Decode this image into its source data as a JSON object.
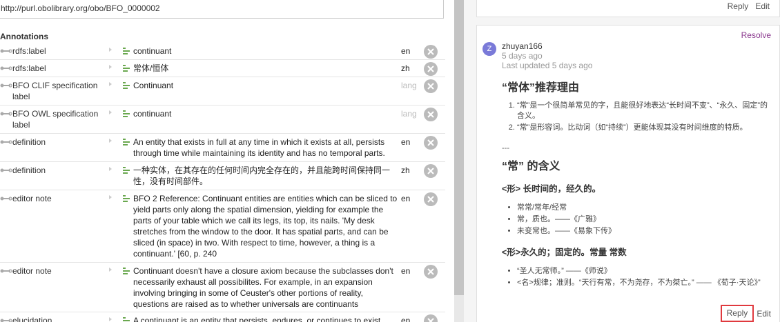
{
  "entity": {
    "iri": "http://purl.obolibrary.org/obo/BFO_0000002"
  },
  "annotations": {
    "heading": "Annotations",
    "rows": [
      {
        "property": "rdfs:label",
        "value": "continuant",
        "lang": "en",
        "lang_placeholder": false
      },
      {
        "property": "rdfs:label",
        "value": "常体/恒体",
        "lang": "zh",
        "lang_placeholder": false
      },
      {
        "property": "BFO CLIF specification label",
        "value": "Continuant",
        "lang": "lang",
        "lang_placeholder": true
      },
      {
        "property": "BFO OWL specification label",
        "value": "continuant",
        "lang": "lang",
        "lang_placeholder": true
      },
      {
        "property": "definition",
        "value": "An entity that exists in full at any time in which it exists at all, persists through time while maintaining its identity and has no temporal parts.",
        "lang": "en",
        "lang_placeholder": false
      },
      {
        "property": "definition",
        "value": "一种实体，在其存在的任何时间内完全存在的，并且能跨时间保持同一性，没有时间部件。",
        "lang": "zh",
        "lang_placeholder": false
      },
      {
        "property": "editor note",
        "value": "BFO 2 Reference: Continuant entities are entities which can be sliced to yield parts only along the spatial dimension, yielding for example the parts of your table which we call its legs, its top, its nails. 'My desk stretches from the window to the door. It has spatial parts, and can be sliced (in space) in two. With respect to time, however, a thing is a continuant.' [60, p. 240",
        "lang": "en",
        "lang_placeholder": false
      },
      {
        "property": "editor note",
        "value": "Continuant doesn't have a closure axiom because the subclasses don't necessarily exhaust all possibilites. For example, in an expansion involving bringing in some of Ceuster's other portions of reality, questions are raised as to whether universals are continuants",
        "lang": "en",
        "lang_placeholder": false
      },
      {
        "property": "elucidation",
        "value": "A continuant is an entity that persists, endures, or continues to exist",
        "lang": "en",
        "lang_placeholder": false
      }
    ]
  },
  "comments": {
    "previous_actions": {
      "reply": "Reply",
      "edit": "Edit"
    },
    "thread": {
      "resolve": "Resolve",
      "avatar_letter": "Z",
      "author": "zhuyan166",
      "ago": "5 days ago",
      "updated": "Last updated 5 days ago",
      "title1": "“常体”推荐理由",
      "reasons": [
        "“常”是一个很简单常见的字，且能很好地表达“长时间不变”、“永久、固定”的含义。",
        "“常”是形容词。比动词（如“持续”）更能体现其没有时间维度的特质。"
      ],
      "separator": "---",
      "title2": "“常” 的含义",
      "sense1_heading": "<形> 长时间的，经久的。",
      "sense1_items": [
        "常常/常年/经常",
        "常，质也。——《广雅》",
        "未变常也。——《易象下传》"
      ],
      "sense2_heading": "<形>永久的；固定的。常量 常数",
      "sense2_items": [
        "“圣人无常师。” ——《师说》",
        "<名>规律；准则。“天行有常，不为尧存，不为桀亡。” —— 《荀子·天论》”"
      ],
      "reply": "Reply",
      "edit": "Edit"
    }
  }
}
